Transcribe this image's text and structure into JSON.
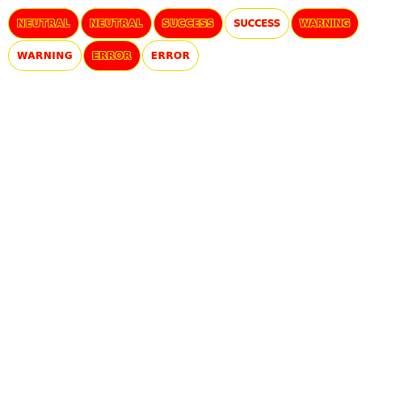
{
  "colors": {
    "accent": "#ff0000",
    "border": "#f0dc00",
    "background": "#ffffff"
  },
  "badges": [
    {
      "label": "NEUTRAL",
      "style": "solid"
    },
    {
      "label": "NEUTRAL",
      "style": "solid"
    },
    {
      "label": "SUCCESS",
      "style": "solid"
    },
    {
      "label": "SUCCESS",
      "style": "outline"
    },
    {
      "label": "WARNING",
      "style": "solid"
    },
    {
      "label": "WARNING",
      "style": "outline"
    },
    {
      "label": "ERROR",
      "style": "solid"
    },
    {
      "label": "ERROR",
      "style": "outline"
    }
  ]
}
